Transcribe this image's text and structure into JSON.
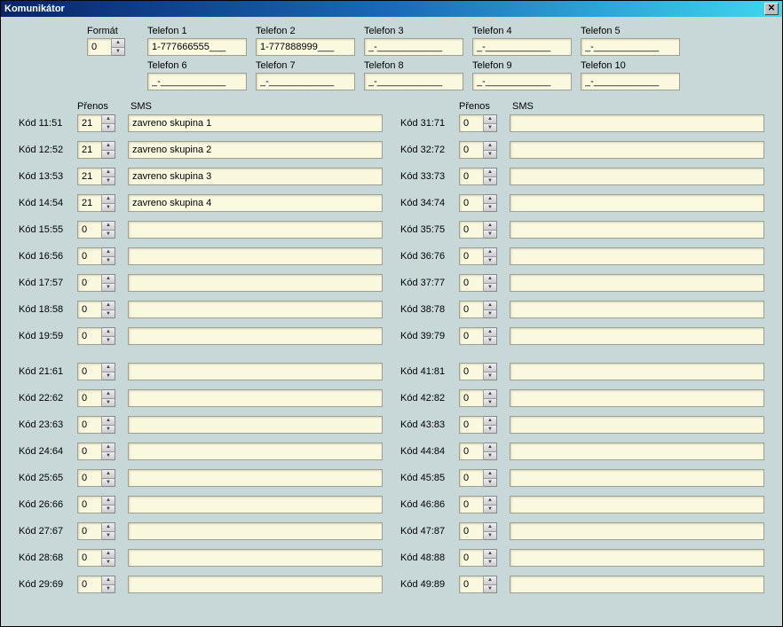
{
  "title": "Komunikátor",
  "labels": {
    "format": "Formát",
    "prenos": "Přenos",
    "sms": "SMS"
  },
  "format_value": "0",
  "telefons": [
    {
      "label": "Telefon 1",
      "value": "1-777666555___"
    },
    {
      "label": "Telefon 2",
      "value": "1-777888999___"
    },
    {
      "label": "Telefon 3",
      "value": "_-____________"
    },
    {
      "label": "Telefon 4",
      "value": "_-____________"
    },
    {
      "label": "Telefon 5",
      "value": "_-____________"
    },
    {
      "label": "Telefon 6",
      "value": "_-____________"
    },
    {
      "label": "Telefon 7",
      "value": "_-____________"
    },
    {
      "label": "Telefon 8",
      "value": "_-____________"
    },
    {
      "label": "Telefon 9",
      "value": "_-____________"
    },
    {
      "label": "Telefon 10",
      "value": "_-____________"
    }
  ],
  "left_group1": [
    {
      "kod": "Kód 11:51",
      "prenos": "21",
      "sms": "zavreno skupina 1"
    },
    {
      "kod": "Kód 12:52",
      "prenos": "21",
      "sms": "zavreno skupina 2"
    },
    {
      "kod": "Kód 13:53",
      "prenos": "21",
      "sms": "zavreno skupina 3"
    },
    {
      "kod": "Kód 14:54",
      "prenos": "21",
      "sms": "zavreno skupina 4"
    },
    {
      "kod": "Kód 15:55",
      "prenos": "0",
      "sms": ""
    },
    {
      "kod": "Kód 16:56",
      "prenos": "0",
      "sms": ""
    },
    {
      "kod": "Kód 17:57",
      "prenos": "0",
      "sms": ""
    },
    {
      "kod": "Kód 18:58",
      "prenos": "0",
      "sms": ""
    },
    {
      "kod": "Kód 19:59",
      "prenos": "0",
      "sms": ""
    }
  ],
  "left_group2": [
    {
      "kod": "Kód 21:61",
      "prenos": "0",
      "sms": ""
    },
    {
      "kod": "Kód 22:62",
      "prenos": "0",
      "sms": ""
    },
    {
      "kod": "Kód 23:63",
      "prenos": "0",
      "sms": ""
    },
    {
      "kod": "Kód 24:64",
      "prenos": "0",
      "sms": ""
    },
    {
      "kod": "Kód 25:65",
      "prenos": "0",
      "sms": ""
    },
    {
      "kod": "Kód 26:66",
      "prenos": "0",
      "sms": ""
    },
    {
      "kod": "Kód 27:67",
      "prenos": "0",
      "sms": ""
    },
    {
      "kod": "Kód 28:68",
      "prenos": "0",
      "sms": ""
    },
    {
      "kod": "Kód 29:69",
      "prenos": "0",
      "sms": ""
    }
  ],
  "right_group1": [
    {
      "kod": "Kód 31:71",
      "prenos": "0",
      "sms": ""
    },
    {
      "kod": "Kód 32:72",
      "prenos": "0",
      "sms": ""
    },
    {
      "kod": "Kód 33:73",
      "prenos": "0",
      "sms": ""
    },
    {
      "kod": "Kód 34:74",
      "prenos": "0",
      "sms": ""
    },
    {
      "kod": "Kód 35:75",
      "prenos": "0",
      "sms": ""
    },
    {
      "kod": "Kód 36:76",
      "prenos": "0",
      "sms": ""
    },
    {
      "kod": "Kód 37:77",
      "prenos": "0",
      "sms": ""
    },
    {
      "kod": "Kód 38:78",
      "prenos": "0",
      "sms": ""
    },
    {
      "kod": "Kód 39:79",
      "prenos": "0",
      "sms": ""
    }
  ],
  "right_group2": [
    {
      "kod": "Kód 41:81",
      "prenos": "0",
      "sms": ""
    },
    {
      "kod": "Kód 42:82",
      "prenos": "0",
      "sms": ""
    },
    {
      "kod": "Kód 43:83",
      "prenos": "0",
      "sms": ""
    },
    {
      "kod": "Kód 44:84",
      "prenos": "0",
      "sms": ""
    },
    {
      "kod": "Kód 45:85",
      "prenos": "0",
      "sms": ""
    },
    {
      "kod": "Kód 46:86",
      "prenos": "0",
      "sms": ""
    },
    {
      "kod": "Kód 47:87",
      "prenos": "0",
      "sms": ""
    },
    {
      "kod": "Kód 48:88",
      "prenos": "0",
      "sms": ""
    },
    {
      "kod": "Kód 49:89",
      "prenos": "0",
      "sms": ""
    }
  ]
}
